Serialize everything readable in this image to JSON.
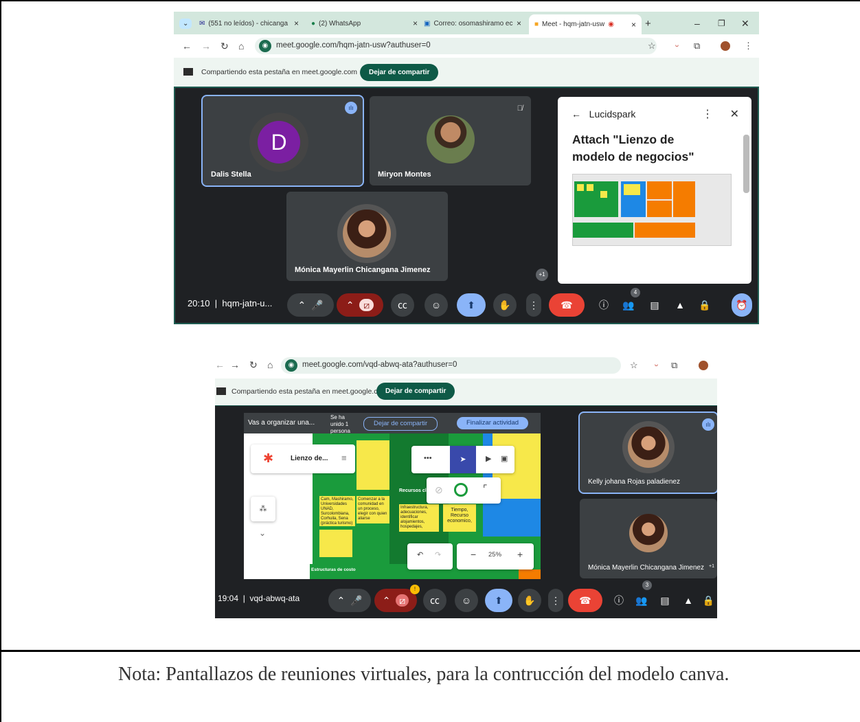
{
  "screenshot1": {
    "tabs": [
      {
        "icon": "gmail-icon",
        "label": "(551 no leídos) - chicanga"
      },
      {
        "icon": "whatsapp-icon",
        "label": "(2) WhatsApp"
      },
      {
        "icon": "outlook-icon",
        "label": "Correo: osomashiramo ec"
      },
      {
        "icon": "meet-icon",
        "label": "Meet - hqm-jatn-usw"
      }
    ],
    "url": "meet.google.com/hqm-jatn-usw?authuser=0",
    "share_text": "Compartiendo esta pestaña en meet.google.com",
    "stop_share": "Dejar de compartir",
    "participants": [
      {
        "initial": "D",
        "name": "Dalis Stella"
      },
      {
        "name": "Miryon Montes"
      },
      {
        "name": "Mónica Mayerlin Chicangana Jimenez"
      }
    ],
    "more_count": "+1",
    "panel": {
      "app": "Lucidspark",
      "title": "Attach \"Lienzo de modelo de negocios\""
    },
    "time": "20:10",
    "meeting_code": "hqm-jatn-u...",
    "people_count": "4"
  },
  "screenshot2": {
    "url": "meet.google.com/vqd-abwq-ata?authuser=0",
    "share_text": "Compartiendo esta pestaña en meet.google.com",
    "stop_share": "Dejar de compartir",
    "activity_text": "Vas a organizar una...",
    "joined_text": "Se ha unido 1 persona",
    "stop_share_pill": "Dejar de compartir",
    "finish_pill": "Finalizar actividad",
    "board_name": "Lienzo de...",
    "zoom": "25%",
    "footer_label": "Estructuras de costo",
    "stickies": [
      "Cam, Mashiramo, Universidades UNAD, Surcolombiana, Corhuila, Sena (práctica turismo)",
      "Comenzar a la comunidad en un proceso, elegir con quien aliarse",
      "Tiempo, Recurso economico,",
      "Infraestructura, adecuaciones, identificar alojamientos, hospedajes,",
      "Recursos cl"
    ],
    "participants": [
      {
        "name": "Kelly johana Rojas paladienez"
      },
      {
        "name": "Mónica Mayerlin Chicangana Jimenez"
      }
    ],
    "more_count": "+1",
    "time": "19:04",
    "meeting_code": "vqd-abwq-ata",
    "people_count": "3",
    "alert": "!"
  },
  "caption": "Nota: Pantallazos de reuniones virtuales, para la contrucción del modelo canva."
}
